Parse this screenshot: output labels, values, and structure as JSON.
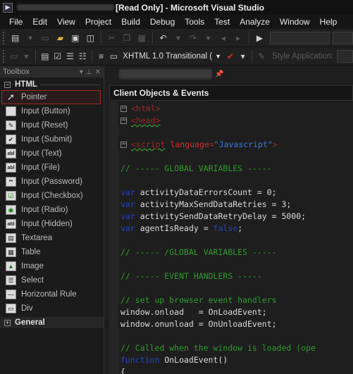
{
  "window": {
    "title": "[Read Only] - Microsoft Visual Studio"
  },
  "menu": {
    "items": [
      "File",
      "Edit",
      "View",
      "Project",
      "Build",
      "Debug",
      "Tools",
      "Test",
      "Analyze",
      "Window",
      "Help"
    ]
  },
  "toolbar2": {
    "doctype_selected": "XHTML 1.0 Transitional (",
    "style_application_label": "Style Application:"
  },
  "toolbox": {
    "title": "Toolbox",
    "group_html": "HTML",
    "group_general": "General",
    "items": [
      {
        "label": "Pointer",
        "icon": "pointer-icon"
      },
      {
        "label": "Input (Button)",
        "icon": "input-button-icon"
      },
      {
        "label": "Input (Reset)",
        "icon": "input-reset-icon"
      },
      {
        "label": "Input (Submit)",
        "icon": "input-submit-icon"
      },
      {
        "label": "Input (Text)",
        "icon": "input-text-icon"
      },
      {
        "label": "Input (File)",
        "icon": "input-file-icon"
      },
      {
        "label": "Input (Password)",
        "icon": "input-password-icon"
      },
      {
        "label": "Input (Checkbox)",
        "icon": "checkbox-icon"
      },
      {
        "label": "Input (Radio)",
        "icon": "radio-icon"
      },
      {
        "label": "Input (Hidden)",
        "icon": "input-hidden-icon"
      },
      {
        "label": "Textarea",
        "icon": "textarea-icon"
      },
      {
        "label": "Table",
        "icon": "table-icon"
      },
      {
        "label": "Image",
        "icon": "image-icon"
      },
      {
        "label": "Select",
        "icon": "select-icon"
      },
      {
        "label": "Horizontal Rule",
        "icon": "horizontal-rule-icon"
      },
      {
        "label": "Div",
        "icon": "div-icon"
      }
    ]
  },
  "editor": {
    "objects_events_label": "Client Objects & Events",
    "code": {
      "html_open": "<html>",
      "head_open": "<head>",
      "script_tag_open": "<script",
      "script_attr": "language",
      "script_eq": "=",
      "script_value": "\"Javascript\"",
      "script_close": ">",
      "comment_globals": "// ----- GLOBAL VARIABLES -----",
      "kw_var": "var",
      "var1": " activityDataErrorsCount = 0;",
      "var2": " activityMaxSendDataRetries = 3;",
      "var3": " activitySendDataRetryDelay = 5000;",
      "var4a": " agentIsReady = ",
      "kw_false": "false",
      "var4b": ";",
      "comment_globals_end": "// ----- /GLOBAL VARIABLES -----",
      "comment_handlers": "// ----- EVENT HANDLERS -----",
      "comment_setup": "// set up browser event handlers",
      "onload_line": "window.onload   = OnLoadEvent;",
      "onunload_line": "window.onunload = OnUnloadEvent;",
      "comment_called": "// Called when the window is loaded (ope",
      "kw_function": "function",
      "func_name": " OnLoadEvent()",
      "brace_open": "{"
    }
  }
}
